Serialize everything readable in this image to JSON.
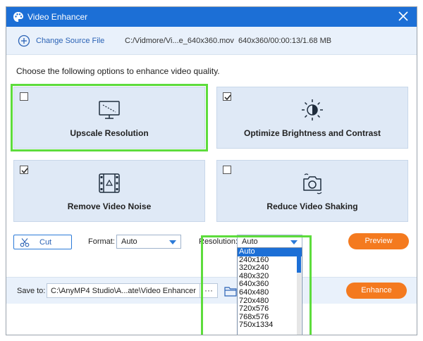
{
  "window": {
    "title": "Video Enhancer"
  },
  "source": {
    "change_label": "Change Source File",
    "file_path": "C:/Vidmore/Vi...e_640x360.mov",
    "file_info": "640x360/00:00:13/1.68 MB"
  },
  "instruction": "Choose the following options to enhance video quality.",
  "options": [
    {
      "label": "Upscale Resolution",
      "checked": false,
      "icon": "monitor-icon",
      "highlighted": true
    },
    {
      "label": "Optimize Brightness and Contrast",
      "checked": true,
      "icon": "brightness-icon",
      "highlighted": false
    },
    {
      "label": "Remove Video Noise",
      "checked": true,
      "icon": "film-icon",
      "highlighted": false
    },
    {
      "label": "Reduce Video Shaking",
      "checked": false,
      "icon": "camera-icon",
      "highlighted": false
    }
  ],
  "controls": {
    "cut_label": "Cut",
    "format_label": "Format:",
    "format_value": "Auto",
    "resolution_label": "Resolution:",
    "resolution_value": "Auto",
    "preview_label": "Preview"
  },
  "resolution_options": [
    "Auto",
    "240x160",
    "320x240",
    "480x320",
    "640x360",
    "640x480",
    "720x480",
    "720x576",
    "768x576",
    "750x1334"
  ],
  "save": {
    "label": "Save to:",
    "path": "C:\\AnyMP4 Studio\\A...ate\\Video Enhancer",
    "browse_label": "···",
    "enhance_label": "Enhance"
  },
  "colors": {
    "accent": "#1c6fd6",
    "orange": "#f47a1f",
    "highlight": "#5ddc3c",
    "card": "#dfe9f6"
  }
}
